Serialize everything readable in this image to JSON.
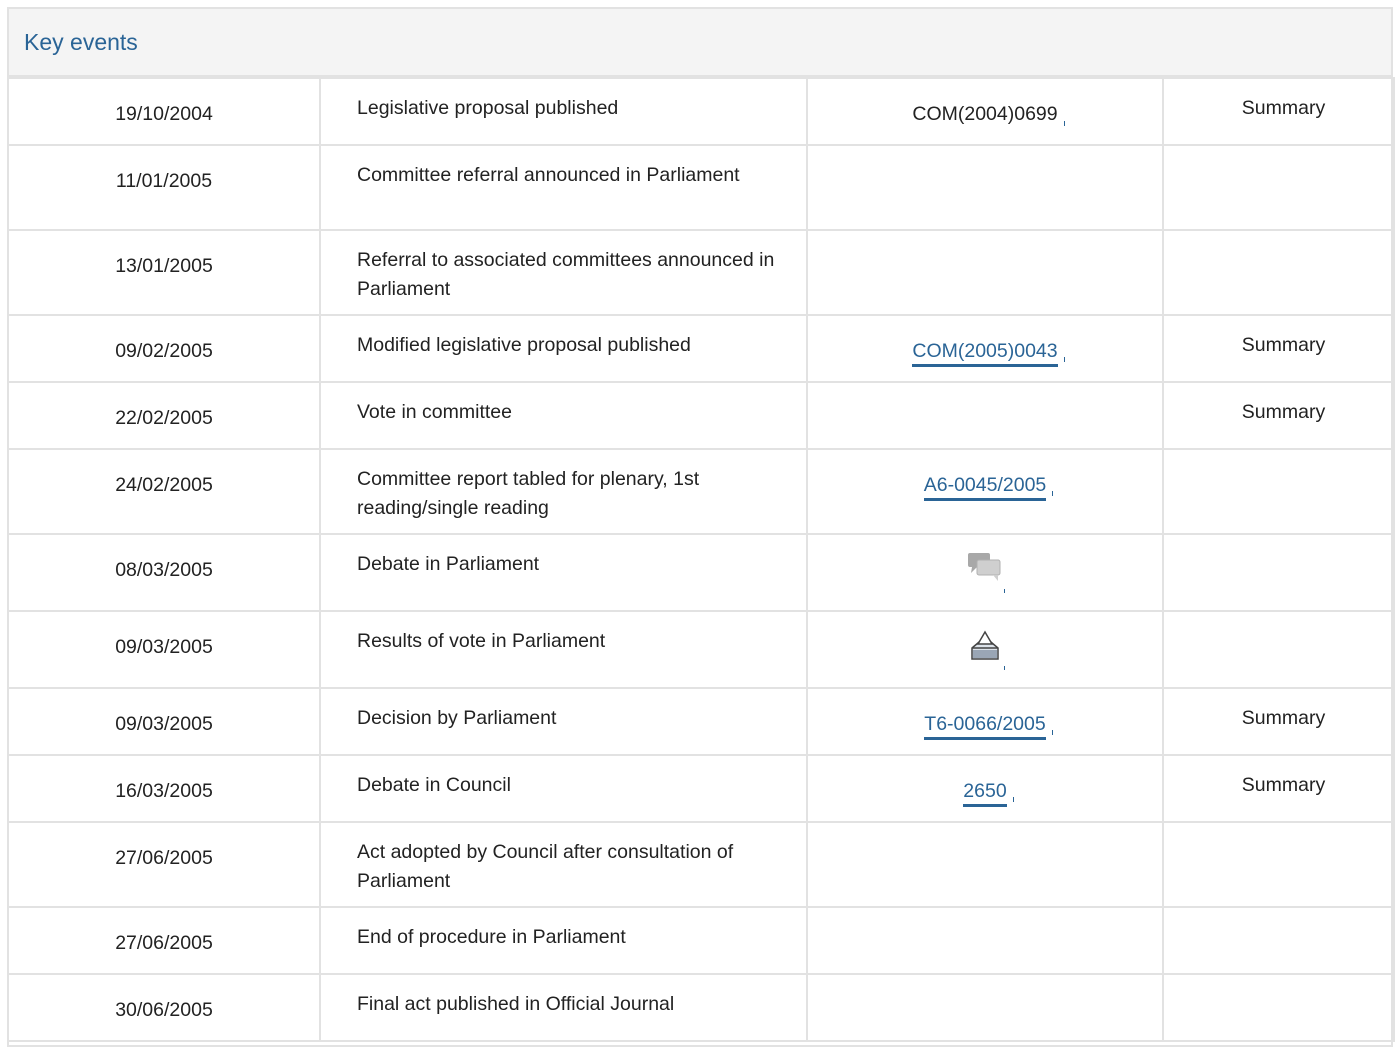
{
  "panel": {
    "title": "Key events"
  },
  "rows": [
    {
      "date": "19/10/2004",
      "event": "Legislative proposal published",
      "doc": "COM(2004)0699",
      "doc_link": false,
      "summary": "Summary"
    },
    {
      "date": "11/01/2005",
      "event": "Committee referral announced in Parliament",
      "doc": "",
      "summary": ""
    },
    {
      "date": "13/01/2005",
      "event": "Referral to associated committees announced in Parliament",
      "doc": "",
      "summary": ""
    },
    {
      "date": "09/02/2005",
      "event": "Modified legislative proposal published",
      "doc": "COM(2005)0043",
      "doc_link": true,
      "summary": "Summary"
    },
    {
      "date": "22/02/2005",
      "event": "Vote in committee",
      "doc": "",
      "summary": "Summary"
    },
    {
      "date": "24/02/2005",
      "event": "Committee report tabled for plenary, 1st reading/single reading",
      "doc": "A6-0045/2005",
      "doc_link": true,
      "summary": ""
    },
    {
      "date": "08/03/2005",
      "event": "Debate in Parliament",
      "doc_icon": "debate-speech-bubbles-icon",
      "summary": ""
    },
    {
      "date": "09/03/2005",
      "event": "Results of vote in Parliament",
      "doc_icon": "ballot-box-vote-icon",
      "summary": ""
    },
    {
      "date": "09/03/2005",
      "event": "Decision by Parliament",
      "doc": "T6-0066/2005",
      "doc_link": true,
      "summary": "Summary"
    },
    {
      "date": "16/03/2005",
      "event": "Debate in Council",
      "doc": "2650",
      "doc_link": true,
      "summary": "Summary"
    },
    {
      "date": "27/06/2005",
      "event": "Act adopted by Council after consultation of Parliament",
      "doc": "",
      "summary": ""
    },
    {
      "date": "27/06/2005",
      "event": "End of procedure in Parliament",
      "doc": "",
      "summary": ""
    },
    {
      "date": "30/06/2005",
      "event": "Final act published in Official Journal",
      "doc": "",
      "summary": ""
    }
  ],
  "colors": {
    "link": "#2a6496",
    "border": "#e2e2e2",
    "header_bg": "#f4f4f4"
  }
}
